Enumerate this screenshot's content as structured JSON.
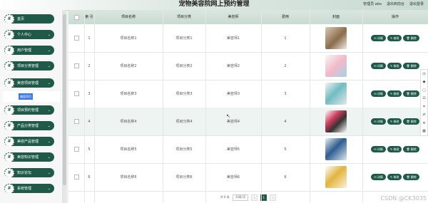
{
  "header": {
    "title": "宠物美容院网上预约管理",
    "links": [
      "管理员 abo",
      "退出到前台",
      "退出登录"
    ]
  },
  "sidebar": {
    "items": [
      {
        "label": "首页",
        "chev": ""
      },
      {
        "label": "个人中心",
        "chev": "⌄"
      },
      {
        "label": "用户管理",
        "chev": "⌄"
      },
      {
        "label": "项目分类管理",
        "chev": "⌄"
      },
      {
        "label": "美容项目管理",
        "chev": "⌄"
      },
      {
        "label": "项目预约管理",
        "chev": "⌄"
      },
      {
        "label": "产品分类管理",
        "chev": "⌄"
      },
      {
        "label": "美容产品管理",
        "chev": "⌄"
      },
      {
        "label": "美容知识管理",
        "chev": "⌄"
      },
      {
        "label": "知识论坛",
        "chev": "⌄"
      },
      {
        "label": "系统管理",
        "chev": "⌄"
      }
    ],
    "sub_item": "美容项目"
  },
  "table": {
    "headers": [
      "",
      "索\n引",
      "项目名称",
      "项目分类",
      "美容师",
      "费用",
      "封面",
      "操作"
    ],
    "rows": [
      {
        "idx": "1",
        "name": "项目名称1",
        "cat": "项目分类1",
        "beautician": "美容师1",
        "fee": "1"
      },
      {
        "idx": "2",
        "name": "项目名称2",
        "cat": "项目分类2",
        "beautician": "美容师2",
        "fee": "2"
      },
      {
        "idx": "3",
        "name": "项目名称3",
        "cat": "项目分类3",
        "beautician": "美容师3",
        "fee": "3"
      },
      {
        "idx": "4",
        "name": "项目名称4",
        "cat": "项目分类4",
        "beautician": "美容师4",
        "fee": "4"
      },
      {
        "idx": "5",
        "name": "项目名称5",
        "cat": "项目分类5",
        "beautician": "美容师5",
        "fee": "5"
      },
      {
        "idx": "6",
        "name": "项目名称6",
        "cat": "项目分类6",
        "beautician": "美容师6",
        "fee": "6"
      }
    ],
    "actions": [
      "详情",
      "修改",
      "删除"
    ]
  },
  "pager": {
    "total": "共 6 条",
    "size": "10条/页",
    "current": "1"
  },
  "watermark": "CSDN @CK3035",
  "colors": {
    "brand": "#1f5a48",
    "header_bg": "#c9dbd2"
  }
}
